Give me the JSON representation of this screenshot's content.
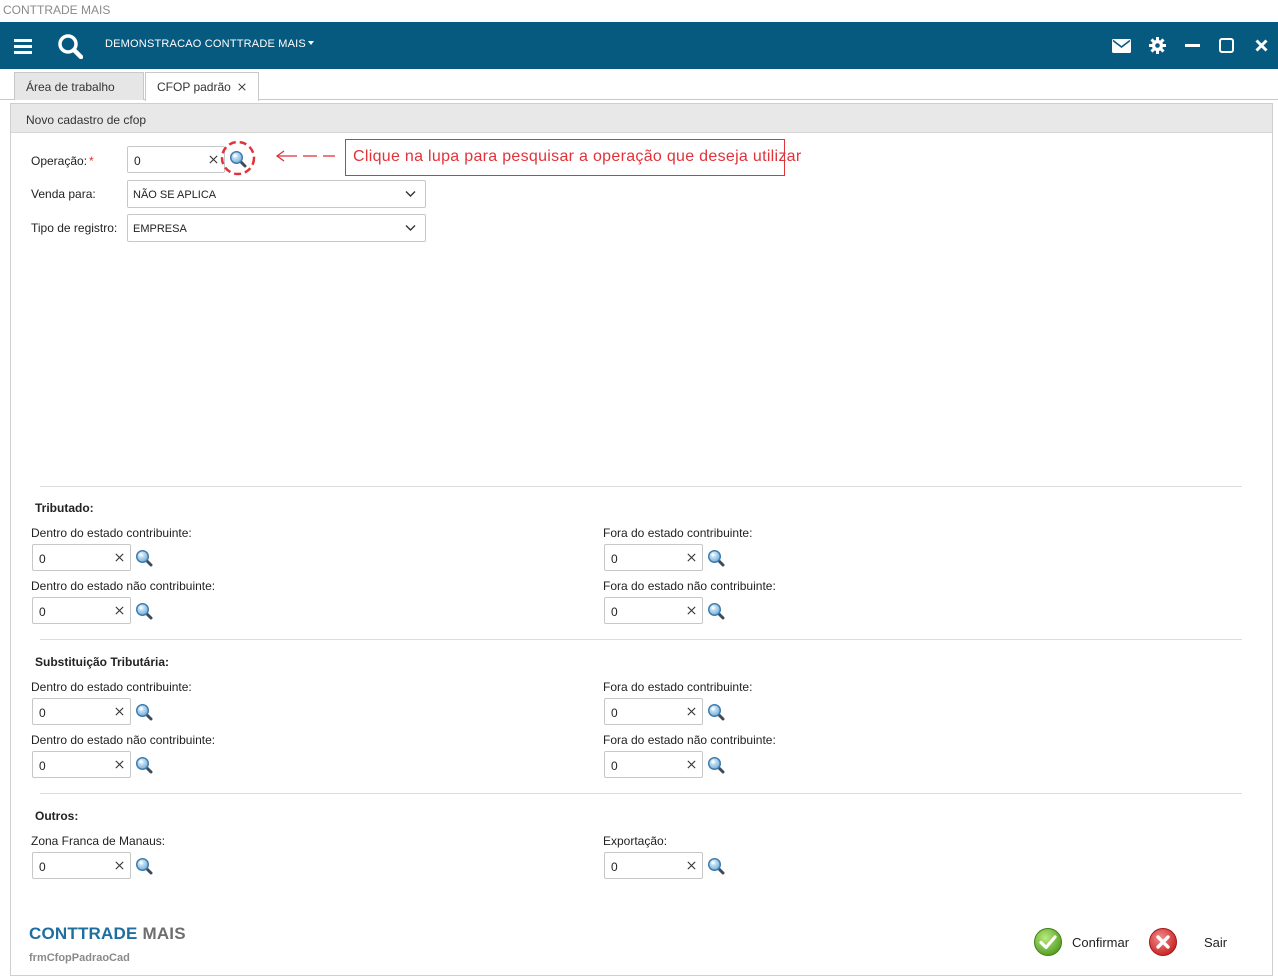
{
  "window": {
    "title": "CONTTRADE MAIS"
  },
  "topbar": {
    "company": "DEMONSTRACAO CONTTRADE MAIS",
    "bg_color": "#065a80"
  },
  "tabs": [
    {
      "label": "Área de trabalho"
    },
    {
      "label": "CFOP padrão"
    }
  ],
  "panel": {
    "title": "Novo cadastro de cfop"
  },
  "form": {
    "operacao": {
      "label": "Operação:",
      "required_mark": "*",
      "value": "0"
    },
    "venda_para": {
      "label": "Venda para:",
      "value": "NÃO SE APLICA"
    },
    "tipo_registro": {
      "label": "Tipo de registro:",
      "value": "EMPRESA"
    }
  },
  "callout": {
    "text": "Clique na lupa para pesquisar a operação que deseja utilizar",
    "color": "#e2323a"
  },
  "sections": {
    "tributado": {
      "title": "Tributado:",
      "dentro_contrib": {
        "label": "Dentro do estado contribuinte:",
        "value": "0"
      },
      "fora_contrib": {
        "label": "Fora do estado contribuinte:",
        "value": "0"
      },
      "dentro_nao_contrib": {
        "label": "Dentro do estado não contribuinte:",
        "value": "0"
      },
      "fora_nao_contrib": {
        "label": "Fora do estado não contribuinte:",
        "value": "0"
      }
    },
    "substituicao": {
      "title": "Substituição Tributária:",
      "dentro_contrib": {
        "label": "Dentro do estado contribuinte:",
        "value": "0"
      },
      "fora_contrib": {
        "label": "Fora do estado contribuinte:",
        "value": "0"
      },
      "dentro_nao_contrib": {
        "label": "Dentro do estado não contribuinte:",
        "value": "0"
      },
      "fora_nao_contrib": {
        "label": "Fora do estado não contribuinte:",
        "value": "0"
      }
    },
    "outros": {
      "title": "Outros:",
      "zona_franca": {
        "label": "Zona Franca de Manaus:",
        "value": "0"
      },
      "exportacao": {
        "label": "Exportação:",
        "value": "0"
      }
    }
  },
  "footer": {
    "brand_main": "CONTTRADE",
    "brand_sub": "MAIS",
    "form_name": "frmCfopPadraoCad",
    "confirm_label": "Confirmar",
    "exit_label": "Sair"
  }
}
